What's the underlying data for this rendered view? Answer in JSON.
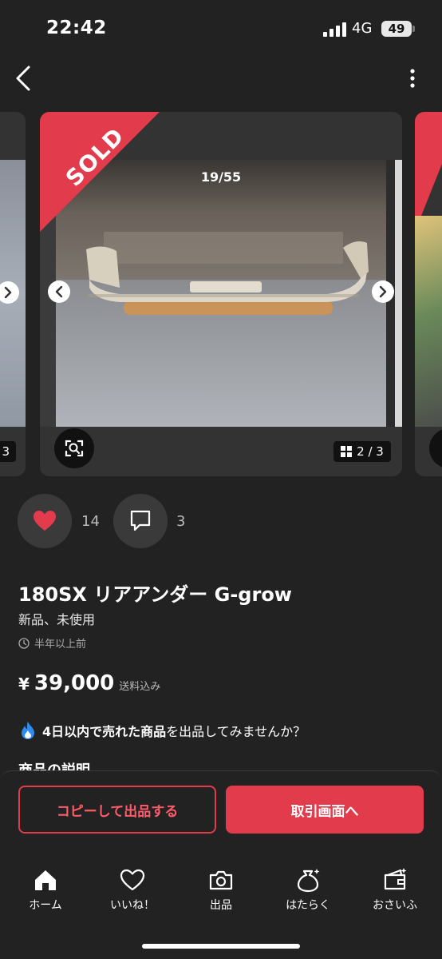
{
  "status_bar": {
    "time": "22:42",
    "network": "4G",
    "battery": "49"
  },
  "product": {
    "sold_label": "SOLD",
    "image_counter": "19/55",
    "page_indicator": "2 / 3",
    "left_card_page": "3",
    "likes": "14",
    "comments": "3",
    "title": "180SX リアアンダー G-grow",
    "condition": "新品、未使用",
    "posted": "半年以上前",
    "price_currency": "¥",
    "price": "39,000",
    "shipping": "送料込み"
  },
  "promo": {
    "bold": "4日以内で売れた商品",
    "rest": "を出品してみませんか？"
  },
  "section_peek": "商品の説明",
  "buttons": {
    "copy": "コピーして出品する",
    "trade": "取引画面へ"
  },
  "tabs": [
    {
      "label": "ホーム",
      "icon": "home-icon"
    },
    {
      "label": "いいね！",
      "icon": "heart-outline-icon"
    },
    {
      "label": "出品",
      "icon": "camera-icon"
    },
    {
      "label": "はたらく",
      "icon": "money-bag-icon"
    },
    {
      "label": "おさいふ",
      "icon": "wallet-icon"
    }
  ],
  "colors": {
    "accent": "#e13b4c",
    "background": "#222222",
    "card": "#333333"
  }
}
